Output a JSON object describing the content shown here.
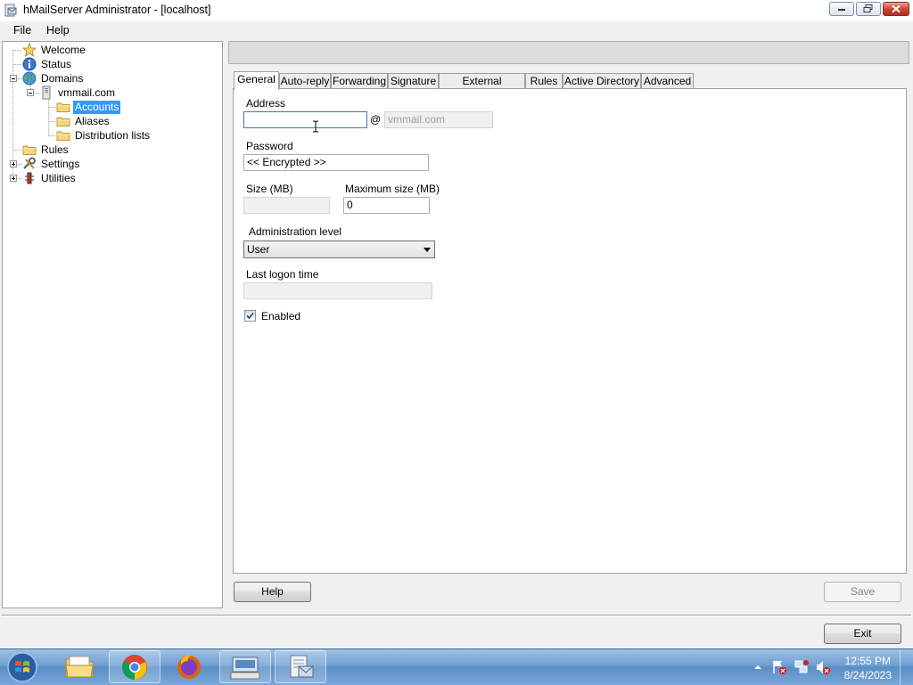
{
  "window": {
    "title": "hMailServer Administrator - [localhost]"
  },
  "menu": {
    "items": [
      "File",
      "Help"
    ]
  },
  "tree": {
    "nodes": [
      {
        "label": "Welcome",
        "icon": "star-icon"
      },
      {
        "label": "Status",
        "icon": "info-icon"
      },
      {
        "label": "Domains",
        "icon": "globe-icon"
      },
      {
        "label": "vmmail.com",
        "icon": "server-icon"
      },
      {
        "label": "Accounts",
        "icon": "folder-icon",
        "selected": true
      },
      {
        "label": "Aliases",
        "icon": "folder-icon"
      },
      {
        "label": "Distribution lists",
        "icon": "folder-icon"
      },
      {
        "label": "Rules",
        "icon": "folder-icon"
      },
      {
        "label": "Settings",
        "icon": "tools-icon"
      },
      {
        "label": "Utilities",
        "icon": "utilities-icon"
      }
    ]
  },
  "tabs": [
    "General",
    "Auto-reply",
    "Forwarding",
    "Signature",
    "External accounts",
    "Rules",
    "Active Directory",
    "Advanced"
  ],
  "active_tab": "General",
  "form": {
    "address_label": "Address",
    "address_value": "",
    "at_symbol": "@",
    "domain_placeholder": "vmmail.com",
    "password_label": "Password",
    "password_value": "<< Encrypted >>",
    "size_label": "Size (MB)",
    "size_value": "",
    "max_size_label": "Maximum size (MB)",
    "max_size_value": "0",
    "admin_level_label": "Administration level",
    "admin_level_value": "User",
    "last_logon_label": "Last logon time",
    "last_logon_value": "",
    "enabled_label": "Enabled",
    "enabled": true
  },
  "buttons": {
    "help": "Help",
    "save": "Save",
    "exit": "Exit"
  },
  "taskbar": {
    "apps": [
      "start-orb-icon",
      "file-explorer-icon",
      "chrome-icon",
      "firefox-icon",
      "keyboard-app-icon",
      "hmailserver-app-icon"
    ],
    "time": "12:55 PM",
    "date": "8/24/2023"
  }
}
